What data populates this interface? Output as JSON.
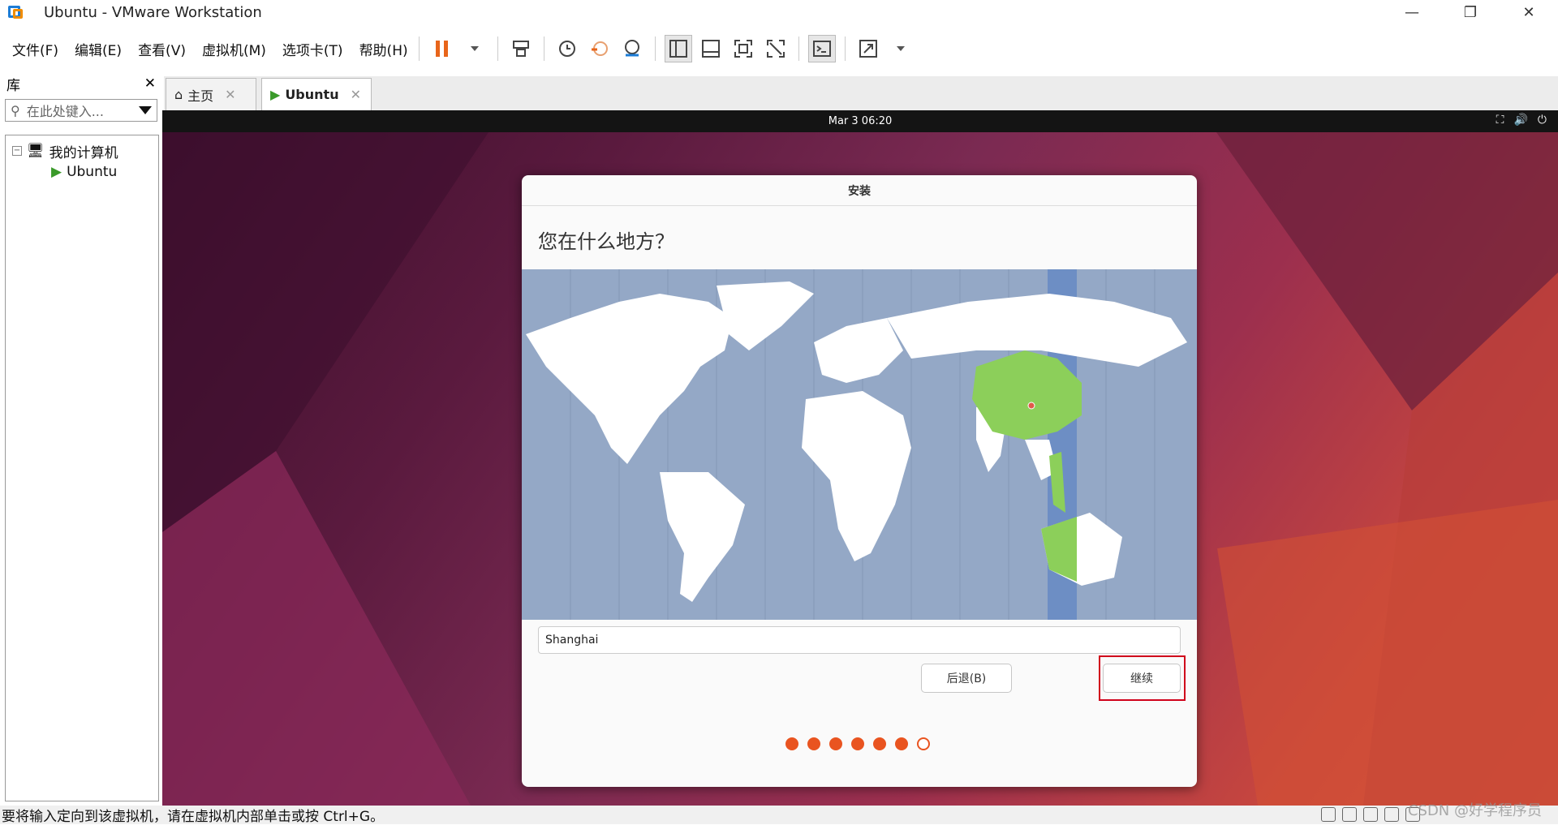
{
  "window": {
    "title": "Ubuntu - VMware Workstation",
    "minimize_icon": "minimize-icon",
    "restore_icon": "restore-icon",
    "close_icon": "close-icon"
  },
  "menu": {
    "items": [
      "文件(F)",
      "编辑(E)",
      "查看(V)",
      "虚拟机(M)",
      "选项卡(T)",
      "帮助(H)"
    ]
  },
  "library": {
    "title": "库",
    "search_placeholder": "在此处键入...",
    "tree_root": "我的计算机",
    "tree_vm": "Ubuntu"
  },
  "tabs": {
    "home_label": "主页",
    "ubuntu_label": "Ubuntu"
  },
  "vm_topbar": {
    "clock": "Mar 3  06:20"
  },
  "installer": {
    "window_title": "安装",
    "heading": "您在什么地方？",
    "timezone_value": "Shanghai",
    "back_label": "后退(B)",
    "continue_label": "继续",
    "progress": {
      "total_steps": 7,
      "completed_steps": 6
    },
    "colors": {
      "accent": "#e95420",
      "map_water": "#94a8c6",
      "map_selected_region": "#8ccf5a",
      "highlight_box": "#d0021b"
    }
  },
  "statusbar": {
    "message": "要将输入定向到该虚拟机，请在虚拟机内部单击或按 Ctrl+G。",
    "watermark": "CSDN @好学程序员"
  }
}
